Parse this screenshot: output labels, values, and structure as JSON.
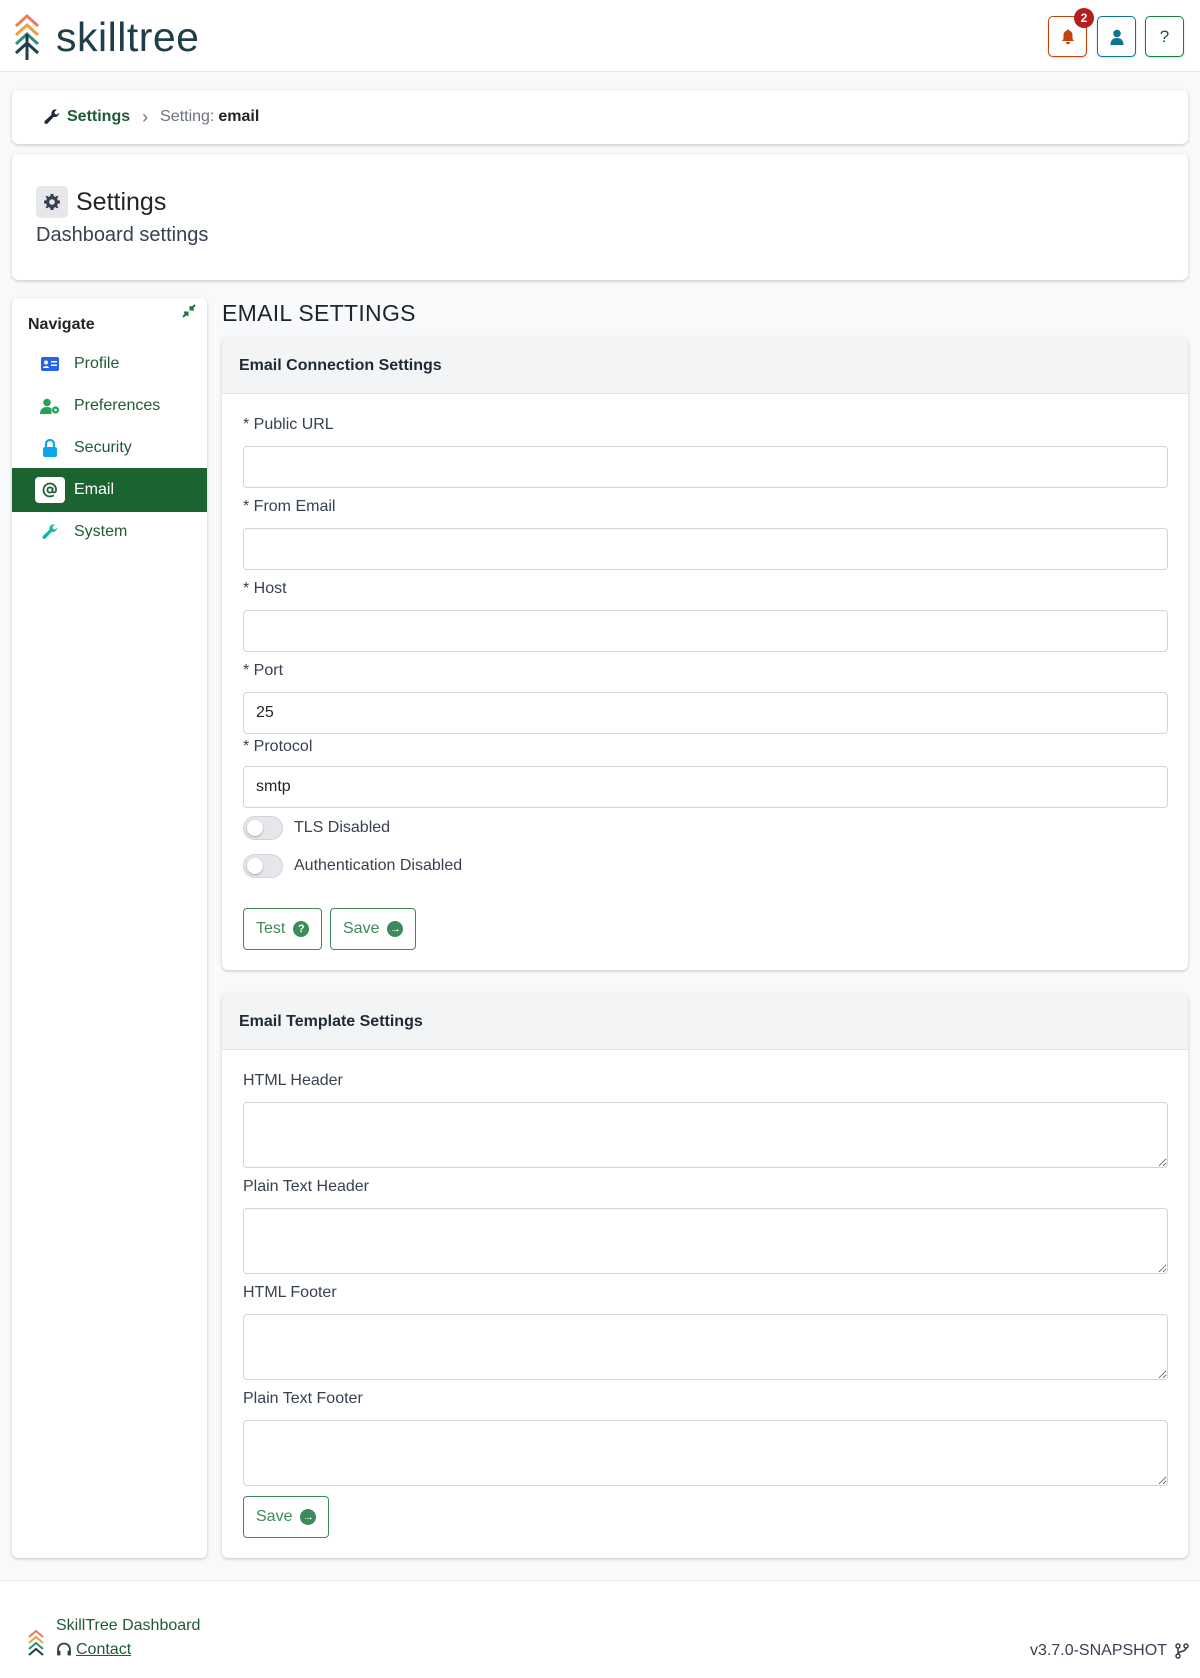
{
  "app": {
    "name": "skilltree"
  },
  "header": {
    "notifications_count": "2",
    "help_label": "?",
    "icons": {
      "bell": "bell-icon",
      "user": "user-icon"
    },
    "colors": {
      "bell": "#c2410c",
      "user": "#0e7490",
      "help": "#15803d"
    }
  },
  "breadcrumb": {
    "root": "Settings",
    "current_label": "Setting:",
    "current_value": "email"
  },
  "page_header": {
    "title": "Settings",
    "subtitle": "Dashboard settings"
  },
  "sidebar": {
    "title": "Navigate",
    "items": [
      {
        "label": "Profile",
        "icon": "id-card-icon",
        "active": false
      },
      {
        "label": "Preferences",
        "icon": "user-cog-icon",
        "active": false
      },
      {
        "label": "Security",
        "icon": "lock-icon",
        "active": false
      },
      {
        "label": "Email",
        "icon": "at-sign-icon",
        "active": true
      },
      {
        "label": "System",
        "icon": "wrench-icon",
        "active": false
      }
    ]
  },
  "main": {
    "section_title": "EMAIL SETTINGS",
    "connection": {
      "title": "Email Connection Settings",
      "public_url": {
        "label": "* Public URL",
        "value": ""
      },
      "from_email": {
        "label": "* From Email",
        "value": ""
      },
      "host": {
        "label": "* Host",
        "value": ""
      },
      "port": {
        "label": "* Port",
        "value": "25"
      },
      "protocol": {
        "label": "* Protocol",
        "value": "smtp"
      },
      "tls_label": "TLS Disabled",
      "auth_label": "Authentication Disabled",
      "test_button": "Test",
      "save_button": "Save"
    },
    "template": {
      "title": "Email Template Settings",
      "html_header_label": "HTML Header",
      "plain_header_label": "Plain Text Header",
      "html_footer_label": "HTML Footer",
      "plain_footer_label": "Plain Text Footer",
      "save_button": "Save"
    }
  },
  "footer": {
    "name": "SkillTree Dashboard",
    "contact": "Contact",
    "version": "v3.7.0-SNAPSHOT"
  },
  "colors": {
    "brand_green": "#1b6331",
    "outline_green": "#3d8b5a"
  }
}
